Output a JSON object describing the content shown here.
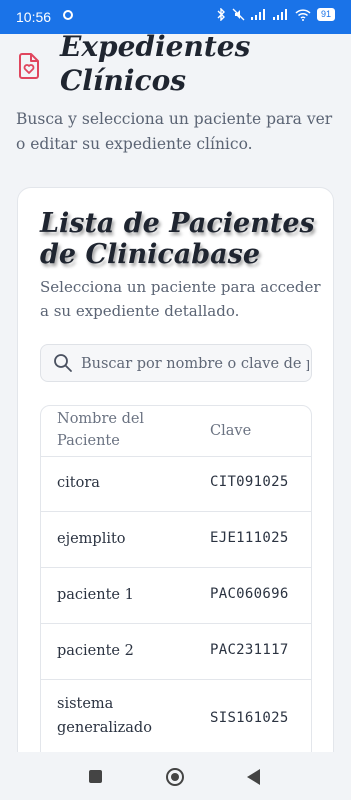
{
  "status_bar": {
    "time": "10:56",
    "battery": "91"
  },
  "header": {
    "title": "Expedientes Clínicos",
    "subtitle": "Busca y selecciona un paciente para ver o editar su expediente clínico."
  },
  "card": {
    "title": "Lista de Pacientes de Clinicabase",
    "subtitle": "Selecciona un paciente para acceder a su expediente detallado.",
    "search": {
      "placeholder": "Buscar por nombre o clave de paciente..."
    },
    "table": {
      "headers": {
        "name": "Nombre del Paciente",
        "clave": "Clave"
      },
      "rows": [
        {
          "name": "citora",
          "clave": "CIT091025"
        },
        {
          "name": "ejemplito",
          "clave": "EJE111025"
        },
        {
          "name": "paciente 1",
          "clave": "PAC060696"
        },
        {
          "name": "paciente 2",
          "clave": "PAC231117"
        },
        {
          "name": "sistema generalizado",
          "clave": "SIS161025"
        }
      ]
    }
  },
  "colors": {
    "accent": "#e0465e",
    "status_bar": "#1a73e8"
  }
}
